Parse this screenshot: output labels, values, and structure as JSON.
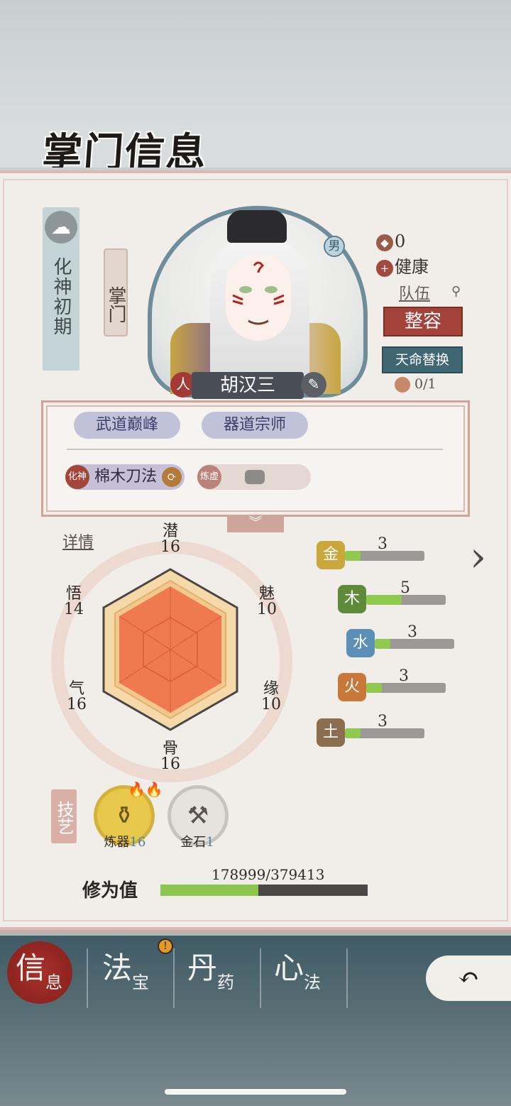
{
  "header": {
    "title": "掌门信息"
  },
  "character": {
    "realm": "化神初期",
    "role": "掌门",
    "gender": "男",
    "name": "胡汉三",
    "name_left_badge": "人",
    "reputation": "0",
    "health": "健康",
    "team_label": "队伍",
    "makeup_button": "整容",
    "fate_button": "天命替换",
    "fate_count": "0/1"
  },
  "traits": [
    {
      "label": "武道巅峰"
    },
    {
      "label": "器道宗师"
    }
  ],
  "techniques": [
    {
      "badge": "化神",
      "label": "棉木刀法"
    },
    {
      "badge": "炼虚",
      "label": ""
    }
  ],
  "stats": {
    "detail_label": "详情",
    "items": {
      "qian": {
        "label": "潜",
        "value": "16"
      },
      "mei": {
        "label": "魅",
        "value": "10"
      },
      "yuan": {
        "label": "缘",
        "value": "10"
      },
      "gu": {
        "label": "骨",
        "value": "16"
      },
      "qi": {
        "label": "气",
        "value": "16"
      },
      "wu": {
        "label": "悟",
        "value": "14"
      }
    }
  },
  "elements": [
    {
      "name": "金",
      "value": "3",
      "level": 0.2,
      "color": "#c9a73b"
    },
    {
      "name": "木",
      "value": "5",
      "level": 0.45,
      "color": "#5f8a3a"
    },
    {
      "name": "水",
      "value": "3",
      "level": 0.2,
      "color": "#5b8fb5"
    },
    {
      "name": "火",
      "value": "3",
      "level": 0.2,
      "color": "#c7783a"
    },
    {
      "name": "土",
      "value": "3",
      "level": 0.2,
      "color": "#8a6e4f"
    }
  ],
  "skills": {
    "section_label": "技艺",
    "items": [
      {
        "name": "炼器",
        "level": "16"
      },
      {
        "name": "金石",
        "level": "1"
      }
    ]
  },
  "cultivation": {
    "label": "修为值",
    "text": "178999/379413",
    "progress": 0.472
  },
  "nav": {
    "items": [
      {
        "main": "信",
        "sub": "息"
      },
      {
        "main": "法",
        "sub": "宝"
      },
      {
        "main": "丹",
        "sub": "药"
      },
      {
        "main": "心",
        "sub": "法"
      }
    ],
    "alert": "!"
  }
}
